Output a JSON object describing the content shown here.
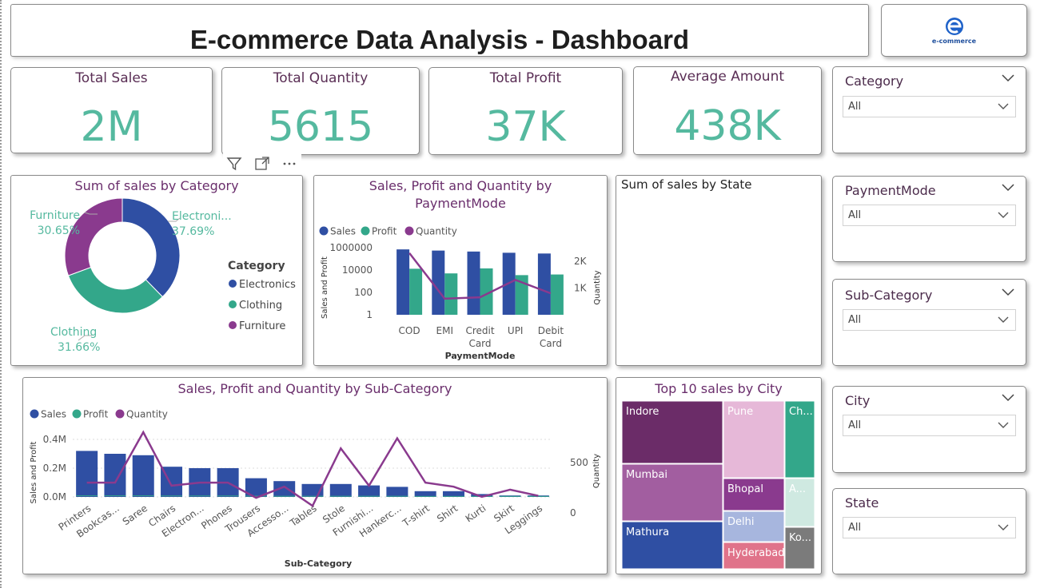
{
  "header": {
    "title": "E-commerce Data Analysis - Dashboard",
    "logo_text": "e-commerce"
  },
  "kpis": [
    {
      "label": "Total Sales",
      "value": "2M"
    },
    {
      "label": "Total Quantity",
      "value": "5615"
    },
    {
      "label": "Total Profit",
      "value": "37K"
    },
    {
      "label": "Average Amount",
      "value": "438K"
    }
  ],
  "visual_toolbar": {
    "icons": [
      "filter-icon",
      "focus-mode-icon",
      "more-options-icon"
    ]
  },
  "slicers": [
    {
      "label": "Category",
      "value": "All"
    },
    {
      "label": "PaymentMode",
      "value": "All"
    },
    {
      "label": "Sub-Category",
      "value": "All"
    },
    {
      "label": "City",
      "value": "All"
    },
    {
      "label": "State",
      "value": "All"
    }
  ],
  "colors": {
    "sales": "#2f4fa3",
    "profit": "#33a78a",
    "quantity": "#8a3a8e",
    "kpi": "#55b99f",
    "title": "#6a2e6c"
  },
  "chart_data": [
    {
      "id": "donut",
      "type": "pie",
      "title": "Sum of sales by Category",
      "legend_title": "Category",
      "legend_position": "right",
      "slices": [
        {
          "name": "Electronics",
          "label": "Electroni...",
          "percent": 37.69,
          "percent_label": "37.69%",
          "color": "#2f4fa3"
        },
        {
          "name": "Clothing",
          "label": "Clothing",
          "percent": 31.66,
          "percent_label": "31.66%",
          "color": "#33a78a"
        },
        {
          "name": "Furniture",
          "label": "Furniture",
          "percent": 30.65,
          "percent_label": "30.65%",
          "color": "#8a3a8e"
        }
      ]
    },
    {
      "id": "payment",
      "type": "bar",
      "title": "Sales, Profit and Quantity by PaymentMode",
      "xlabel": "PaymentMode",
      "ylabel": "Sales and Profit",
      "y2label": "Quantity",
      "yscale": "log",
      "yticks": [
        1,
        100,
        10000,
        1000000
      ],
      "ytick_labels": [
        "1",
        "100",
        "10000",
        "1000000"
      ],
      "y2ticks": [
        1000,
        2000
      ],
      "y2tick_labels": [
        "1K",
        "2K"
      ],
      "y2lim": [
        0,
        2500
      ],
      "categories": [
        "COD",
        "EMI",
        "Credit Card",
        "UPI",
        "Debit Card"
      ],
      "series": [
        {
          "name": "Sales",
          "kind": "bar",
          "values": [
            700000,
            550000,
            450000,
            350000,
            300000
          ]
        },
        {
          "name": "Profit",
          "kind": "bar",
          "values": [
            13000,
            5000,
            14000,
            3500,
            4000
          ]
        },
        {
          "name": "Quantity",
          "kind": "line",
          "values": [
            2300,
            600,
            650,
            1300,
            800
          ]
        }
      ],
      "legend_position": "top-left"
    },
    {
      "id": "state",
      "type": "map",
      "title": "Sum of sales by State"
    },
    {
      "id": "subcat",
      "type": "bar",
      "title": "Sales, Profit and Quantity by Sub-Category",
      "xlabel": "Sub-Category",
      "ylabel": "Sales and Profit",
      "y2label": "Quantity",
      "ylim": [
        0,
        0.45
      ],
      "yticks": [
        0.0,
        0.2,
        0.4
      ],
      "ytick_labels": [
        "0.0M",
        "0.2M",
        "0.4M"
      ],
      "y2lim": [
        0,
        800
      ],
      "y2ticks": [
        0,
        500
      ],
      "y2tick_labels": [
        "0",
        "500"
      ],
      "categories": [
        "Printers",
        "Bookcas...",
        "Saree",
        "Chairs",
        "Electron...",
        "Phones",
        "Trousers",
        "Accesso...",
        "Tables",
        "Stole",
        "Furnishi...",
        "Hankerc...",
        "T-shirt",
        "Shirt",
        "Kurti",
        "Skirt",
        "Leggings"
      ],
      "series": [
        {
          "name": "Sales",
          "kind": "bar",
          "values": [
            0.32,
            0.3,
            0.29,
            0.21,
            0.2,
            0.2,
            0.13,
            0.11,
            0.09,
            0.09,
            0.08,
            0.07,
            0.04,
            0.04,
            0.02,
            0.01,
            0.01
          ]
        },
        {
          "name": "Profit",
          "kind": "bar",
          "values": [
            0.005,
            0.005,
            0.005,
            0.004,
            0.004,
            0.004,
            0.003,
            0.002,
            0.002,
            0.002,
            0.002,
            0.002,
            0.001,
            0.001,
            0.001,
            0.001,
            0.001
          ]
        },
        {
          "name": "Quantity",
          "kind": "line",
          "values": [
            300,
            300,
            800,
            270,
            300,
            300,
            150,
            260,
            70,
            640,
            270,
            740,
            300,
            260,
            160,
            230,
            170
          ]
        }
      ],
      "legend_position": "top-left"
    },
    {
      "id": "city",
      "type": "treemap",
      "title": "Top 10 sales by City",
      "cells": [
        {
          "name": "Indore",
          "color": "#6b2c68"
        },
        {
          "name": "Mumbai",
          "color": "#a25ea0"
        },
        {
          "name": "Mathura",
          "color": "#2f4fa3"
        },
        {
          "name": "Pune",
          "color": "#e6b8d8"
        },
        {
          "name": "Bhopal",
          "color": "#8a3a8e"
        },
        {
          "name": "Delhi",
          "color": "#a7b6de"
        },
        {
          "name": "Hyderabad",
          "color": "#e0738a"
        },
        {
          "name": "Ch...",
          "color": "#33a78a"
        },
        {
          "name": "A...",
          "color": "#cfe9e1"
        },
        {
          "name": "Ko...",
          "color": "#7b7b7b"
        }
      ]
    }
  ]
}
